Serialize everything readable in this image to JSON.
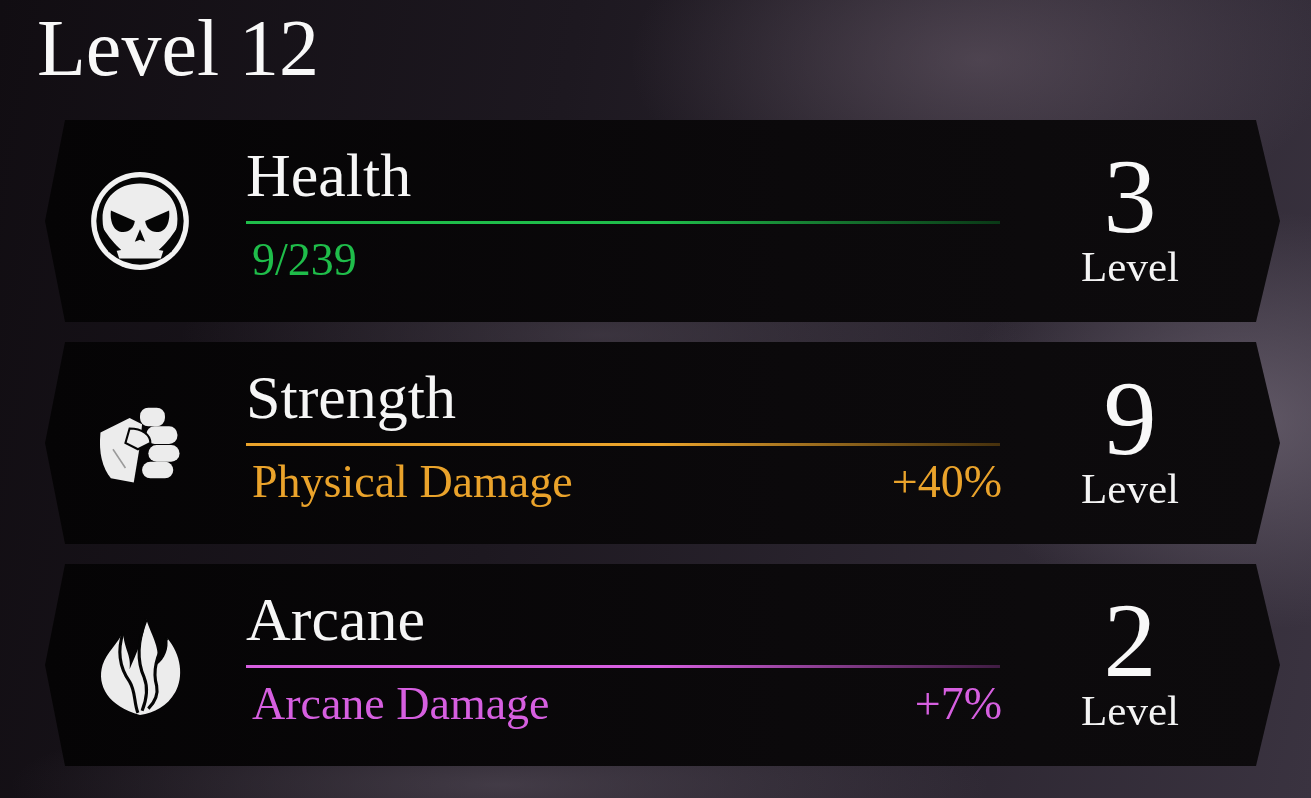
{
  "header": {
    "title": "Level 12"
  },
  "stats": [
    {
      "name": "Health",
      "color": "#1fbd4a",
      "detail": "9/239",
      "rank": "3",
      "rank_label": "Level"
    },
    {
      "name": "Strength",
      "color": "#eaa32b",
      "detail": "Physical Damage",
      "bonus": "+40%",
      "rank": "9",
      "rank_label": "Level"
    },
    {
      "name": "Arcane",
      "color": "#d65fe0",
      "detail": "Arcane Damage",
      "bonus": "+7%",
      "rank": "2",
      "rank_label": "Level"
    }
  ]
}
